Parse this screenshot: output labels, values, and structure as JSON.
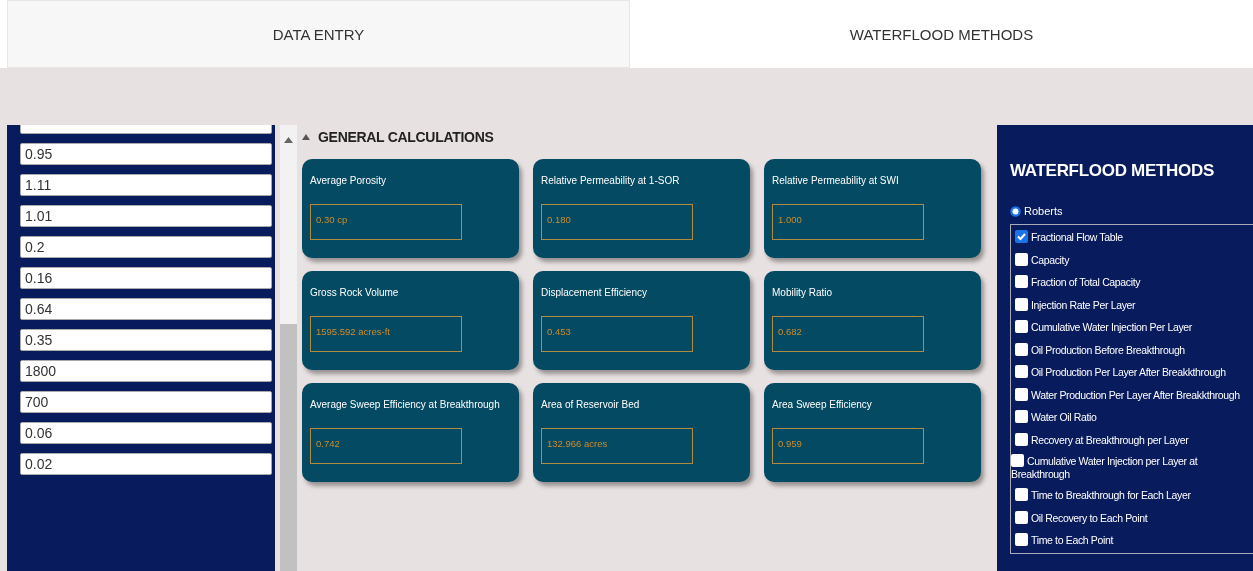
{
  "tabs": [
    {
      "label": "DATA ENTRY",
      "selected": false
    },
    {
      "label": "WATERFLOOD METHODS",
      "selected": true
    }
  ],
  "inputs": [
    "0.95",
    "1.11",
    "1.01",
    "0.2",
    "0.16",
    "0.64",
    "0.35",
    "1800",
    "700",
    "0.06",
    "0.02"
  ],
  "section": {
    "title": "GENERAL CALCULATIONS",
    "expanded": true
  },
  "cards": [
    {
      "title": "Average Porosity",
      "value": "0.30 cp"
    },
    {
      "title": "Relative Permeability at 1-SOR",
      "value": "0.180"
    },
    {
      "title": "Relative Permeability at SWI",
      "value": "1.000"
    },
    {
      "title": "Gross Rock Volume",
      "value": "1595.592 acres-ft"
    },
    {
      "title": "Displacement Efficiency",
      "value": "0.453"
    },
    {
      "title": "Mobility Ratio",
      "value": "0.682"
    },
    {
      "title": "Average Sweep Efficiency at Breakthrough",
      "value": "0.742"
    },
    {
      "title": "Area of Reservoir Bed",
      "value": "132.966 acres"
    },
    {
      "title": "Area Sweep Efficiency",
      "value": "0.959"
    }
  ],
  "methods_panel": {
    "title": "WATERFLOOD METHODS",
    "radio": {
      "label": "Roberts",
      "selected": true
    },
    "options": [
      {
        "label": "Fractional Flow Table",
        "checked": true
      },
      {
        "label": "Capacity",
        "checked": false
      },
      {
        "label": "Fraction of Total Capacity",
        "checked": false
      },
      {
        "label": "Injection Rate Per Layer",
        "checked": false
      },
      {
        "label": "Cumulative Water Injection Per Layer",
        "checked": false
      },
      {
        "label": "Oil Production Before Breakthrough",
        "checked": false
      },
      {
        "label": "Oil Production Per Layer After Breakkthrough",
        "checked": false
      },
      {
        "label": "Water Production Per Layer After Breakkthrough",
        "checked": false
      },
      {
        "label": "Water Oil Ratio",
        "checked": false
      },
      {
        "label": "Recovery at Breakthrough per Layer",
        "checked": false
      },
      {
        "label": "Cumulative Water Injection per Layer at Breakthrough",
        "checked": false
      },
      {
        "label": "Time to Breakthrough for Each Layer",
        "checked": false
      },
      {
        "label": "Oil Recovery to Each Point",
        "checked": false
      },
      {
        "label": "Time to Each Point",
        "checked": false
      }
    ]
  }
}
